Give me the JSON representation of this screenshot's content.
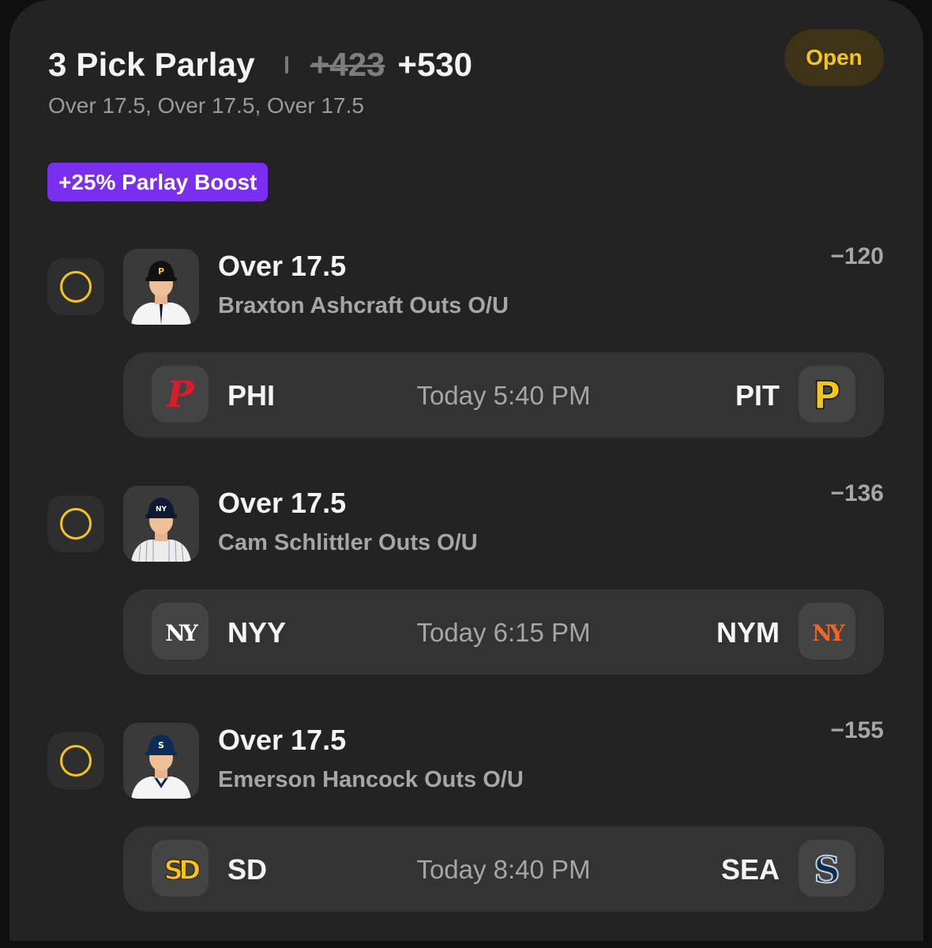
{
  "header": {
    "title": "3 Pick Parlay",
    "original_odds": "+423",
    "boosted_odds": "+530",
    "subtitle": "Over 17.5, Over 17.5, Over 17.5",
    "status": "Open",
    "boost_label": "+25% Parlay Boost"
  },
  "colors": {
    "accent_yellow": "#f5c518",
    "boost_purple": "#7a2ff0",
    "card_bg": "#232323"
  },
  "legs": [
    {
      "pick": "Over 17.5",
      "market": "Braxton Ashcraft Outs O/U",
      "odds": "−120",
      "player_icon": "pirates-player-headshot",
      "game": {
        "away": "PHI",
        "away_logo": "phillies-logo",
        "time": "Today 5:40 PM",
        "home": "PIT",
        "home_logo": "pirates-logo"
      }
    },
    {
      "pick": "Over 17.5",
      "market": "Cam Schlittler Outs O/U",
      "odds": "−136",
      "player_icon": "yankees-player-headshot",
      "game": {
        "away": "NYY",
        "away_logo": "yankees-logo",
        "time": "Today 6:15 PM",
        "home": "NYM",
        "home_logo": "mets-logo"
      }
    },
    {
      "pick": "Over 17.5",
      "market": "Emerson Hancock Outs O/U",
      "odds": "−155",
      "player_icon": "mariners-player-headshot",
      "game": {
        "away": "SD",
        "away_logo": "padres-logo",
        "time": "Today 8:40 PM",
        "home": "SEA",
        "home_logo": "mariners-logo"
      }
    }
  ]
}
